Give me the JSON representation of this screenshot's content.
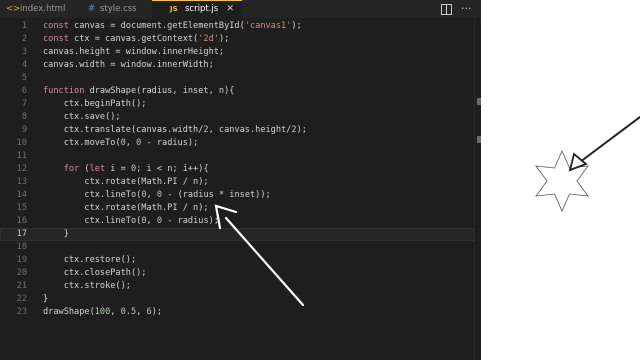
{
  "tabs": [
    {
      "label": "index.html",
      "icon": "html-file-icon"
    },
    {
      "label": "style.css",
      "icon": "css-file-icon"
    },
    {
      "label": "script.js",
      "icon": "js-file-icon",
      "icon_text": "JS",
      "active": true
    }
  ],
  "toolbar": {
    "split_icon": "split-editor-icon",
    "more_icon": "more-actions-icon"
  },
  "code_lines": [
    {
      "ln": "1",
      "tokens": [
        {
          "t": "const ",
          "c": "k"
        },
        {
          "t": "canvas = document.getElementById("
        },
        {
          "t": "'canvas1'",
          "c": "s"
        },
        {
          "t": ");"
        }
      ]
    },
    {
      "ln": "2",
      "tokens": [
        {
          "t": "const ",
          "c": "k"
        },
        {
          "t": "ctx = canvas.getContext("
        },
        {
          "t": "'2d'",
          "c": "s"
        },
        {
          "t": ");"
        }
      ]
    },
    {
      "ln": "3",
      "tokens": [
        {
          "t": "canvas.height = window.innerHeight;"
        }
      ]
    },
    {
      "ln": "4",
      "tokens": [
        {
          "t": "canvas.width = window.innerWidth;"
        }
      ]
    },
    {
      "ln": "5",
      "tokens": []
    },
    {
      "ln": "6",
      "tokens": [
        {
          "t": "function ",
          "c": "k"
        },
        {
          "t": "drawShape(radius, inset, n){"
        }
      ]
    },
    {
      "ln": "7",
      "tokens": [
        {
          "t": "    ctx.beginPath();"
        }
      ]
    },
    {
      "ln": "8",
      "tokens": [
        {
          "t": "    ctx.save();"
        }
      ]
    },
    {
      "ln": "9",
      "tokens": [
        {
          "t": "    ctx.translate(canvas.width/"
        },
        {
          "t": "2",
          "c": "n"
        },
        {
          "t": ", canvas.height/"
        },
        {
          "t": "2",
          "c": "n"
        },
        {
          "t": ");"
        }
      ]
    },
    {
      "ln": "10",
      "tokens": [
        {
          "t": "    ctx.moveTo("
        },
        {
          "t": "0",
          "c": "n"
        },
        {
          "t": ", "
        },
        {
          "t": "0",
          "c": "n"
        },
        {
          "t": " - radius);"
        }
      ]
    },
    {
      "ln": "11",
      "tokens": []
    },
    {
      "ln": "12",
      "tokens": [
        {
          "t": "    "
        },
        {
          "t": "for",
          "c": "k"
        },
        {
          "t": " ("
        },
        {
          "t": "let",
          "c": "k"
        },
        {
          "t": " i = "
        },
        {
          "t": "0",
          "c": "n"
        },
        {
          "t": "; i < n; i++){"
        }
      ]
    },
    {
      "ln": "13",
      "tokens": [
        {
          "t": "        ctx.rotate(Math.PI / n);"
        }
      ]
    },
    {
      "ln": "14",
      "tokens": [
        {
          "t": "        ctx.lineTo("
        },
        {
          "t": "0",
          "c": "n"
        },
        {
          "t": ", "
        },
        {
          "t": "0",
          "c": "n"
        },
        {
          "t": " - (radius * inset));"
        }
      ]
    },
    {
      "ln": "15",
      "tokens": [
        {
          "t": "        ctx.rotate(Math.PI / n);"
        }
      ]
    },
    {
      "ln": "16",
      "tokens": [
        {
          "t": "        ctx.lineTo("
        },
        {
          "t": "0",
          "c": "n"
        },
        {
          "t": ", "
        },
        {
          "t": "0",
          "c": "n"
        },
        {
          "t": " - radius);"
        }
      ]
    },
    {
      "ln": "17",
      "tokens": [
        {
          "t": "    }"
        }
      ],
      "active": true
    },
    {
      "ln": "18",
      "tokens": []
    },
    {
      "ln": "19",
      "tokens": [
        {
          "t": "    ctx.restore();"
        }
      ]
    },
    {
      "ln": "20",
      "tokens": [
        {
          "t": "    ctx.closePath();"
        }
      ]
    },
    {
      "ln": "21",
      "tokens": [
        {
          "t": "    ctx.stroke();"
        }
      ]
    },
    {
      "ln": "22",
      "tokens": [
        {
          "t": "}"
        }
      ]
    },
    {
      "ln": "23",
      "tokens": [
        {
          "t": "drawShape("
        },
        {
          "t": "100",
          "c": "n"
        },
        {
          "t": ", "
        },
        {
          "t": "0.5",
          "c": "n"
        },
        {
          "t": ", "
        },
        {
          "t": "6",
          "c": "n"
        },
        {
          "t": ");"
        }
      ]
    }
  ],
  "canvas_preview": {
    "shape": "six-pointed-star",
    "points": 6,
    "inset": 0.5,
    "stroke_color": "#555555"
  },
  "annotation": {
    "color": "#ffffff",
    "stroke_color": "#222222",
    "icon": "arrow-pointer-icon"
  },
  "colors": {
    "editor_bg": "#1e1e1e",
    "keyword": "#d58d9e",
    "string": "#ce9178",
    "number": "#b5cea8",
    "tab_active_border": "#ffcc00"
  }
}
